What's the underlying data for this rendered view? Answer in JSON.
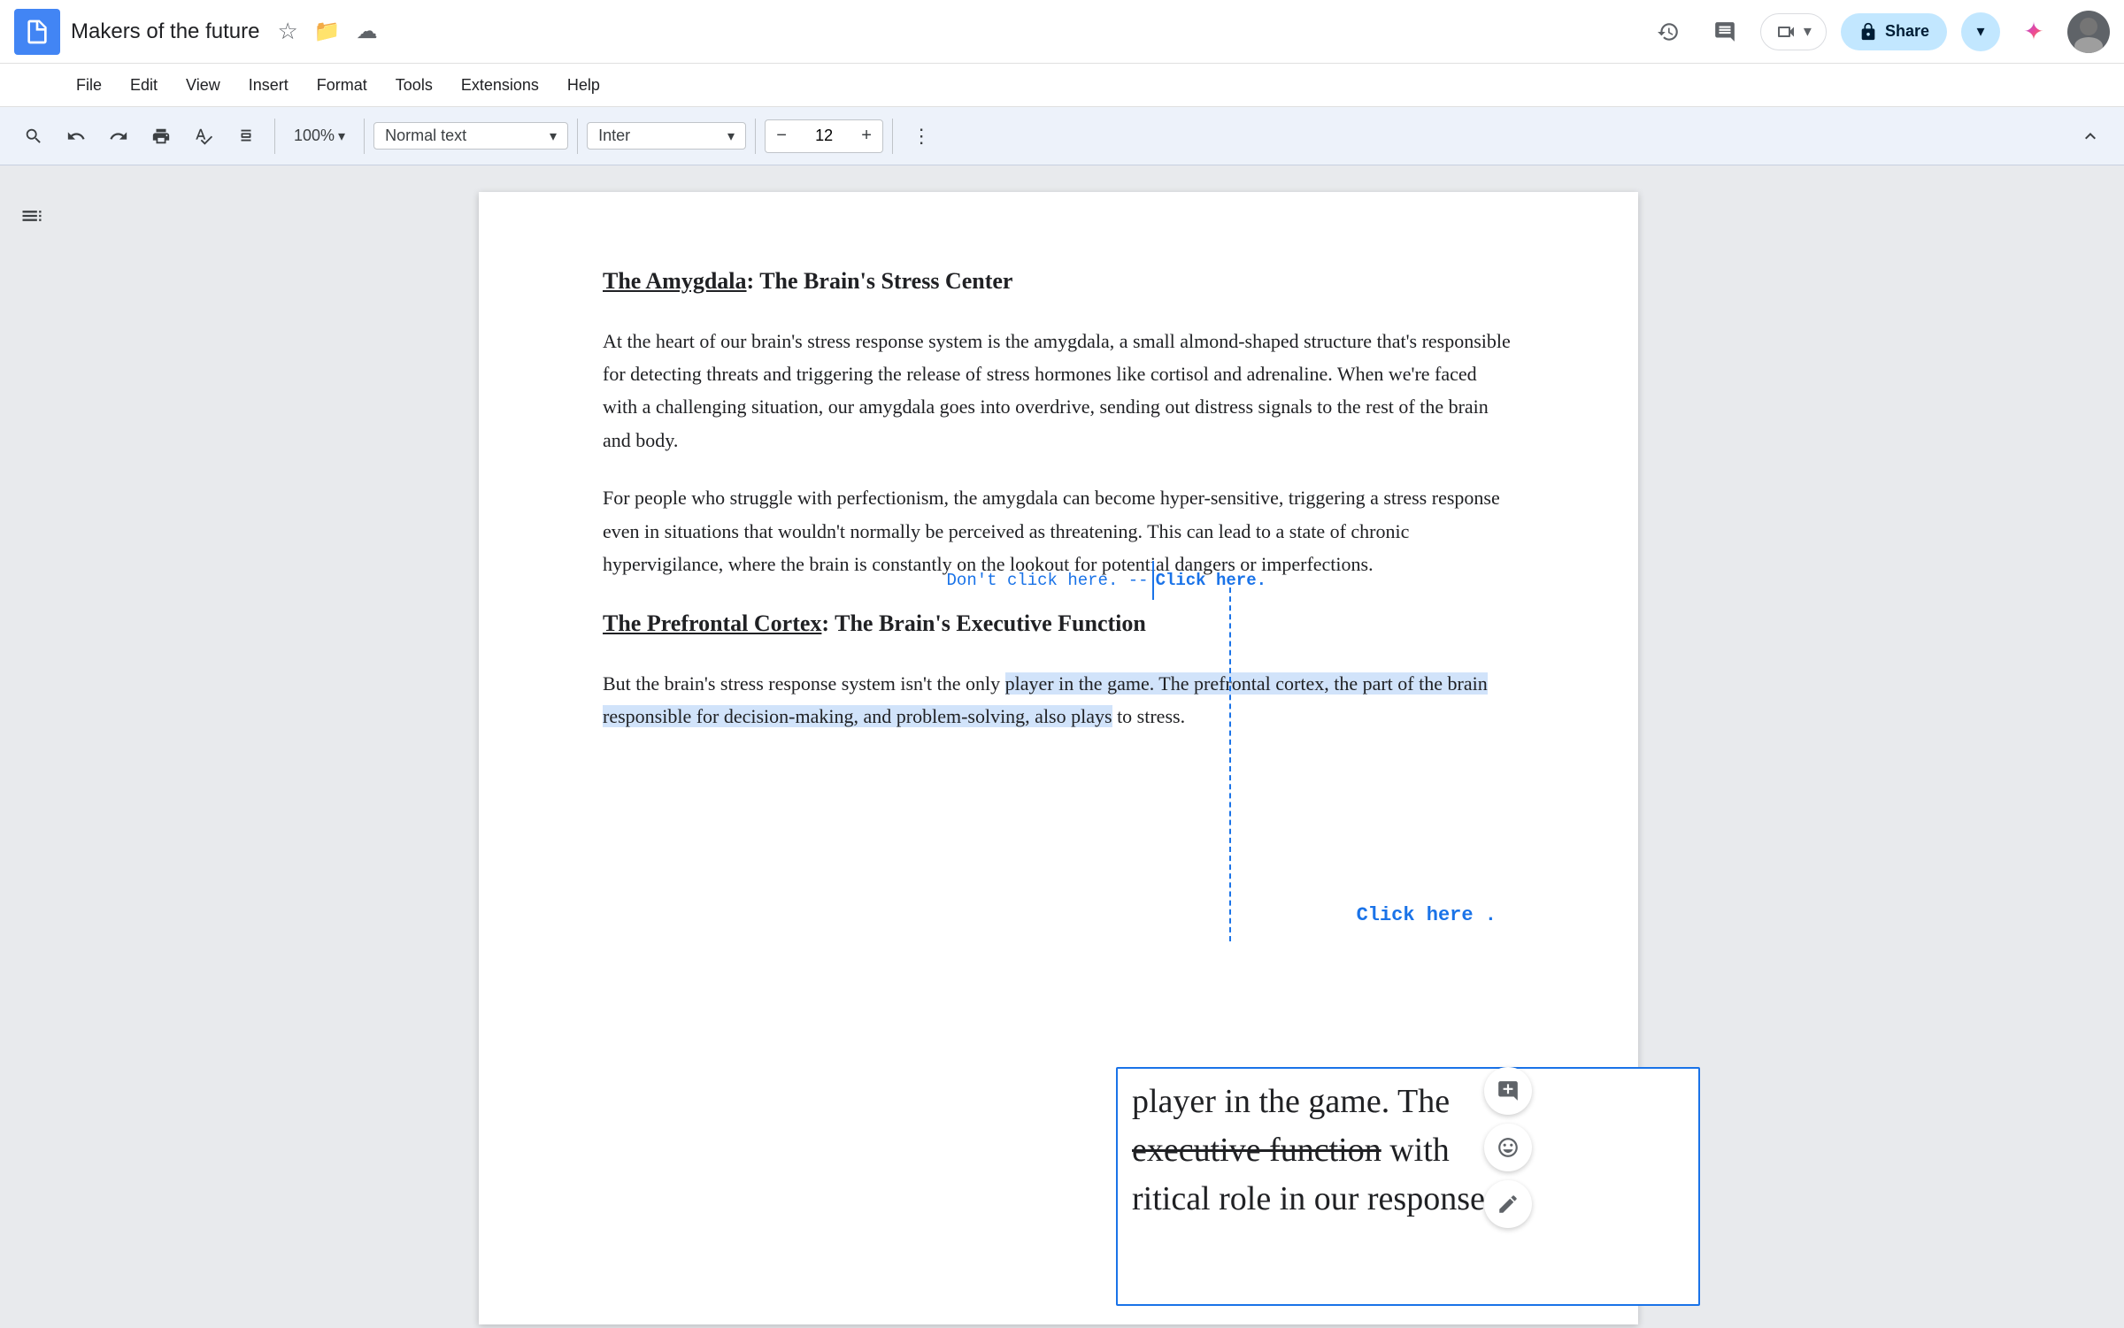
{
  "app": {
    "icon_color": "#4285f4",
    "title": "Makers of the future",
    "actions": {
      "star": "★",
      "save": "⬆",
      "cloud": "☁"
    }
  },
  "toolbar_right": {
    "history_icon": "🕐",
    "comment_icon": "💬",
    "meet_label": "Meet",
    "share_label": "Share",
    "share_icon": "🔒"
  },
  "menu": {
    "items": [
      "File",
      "Edit",
      "View",
      "Insert",
      "Format",
      "Tools",
      "Extensions",
      "Help"
    ]
  },
  "formatting_toolbar": {
    "zoom": "100%",
    "style": "Normal text",
    "font": "Inter",
    "font_size": "12",
    "more_options": "⋮"
  },
  "document": {
    "heading1": "The Amygdala: The Brain's Stress Center",
    "heading1_underline": "The Amygdala",
    "heading1_rest": ": The Brain's Stress Center",
    "para1": "At the heart of our brain's stress response system is the amygdala, a small almond-shaped structure that's responsible for detecting threats and triggering the release of stress hormones like cortisol and adrenaline. When we're faced with a challenging situation, our amygdala goes into overdrive, sending out distress signals to the rest of the brain and body.",
    "para2": "For people who struggle with perfectionism, the amygdala can become hyper-sensitive, triggering a stress response even in situations that wouldn't normally be perceived as threatening. This can lead to a state of chronic hypervigilance, where the brain is constantly on the lookout for potential dangers or imperfections.",
    "heading2": "The Prefrontal Cortex: The Brain's Executive Function",
    "heading2_underline": "The Prefrontal Cortex",
    "heading2_rest": ": The Brain's Executive Function",
    "para3_start": "But the brain's stress response system isn't the only player in the game. The prefrontal cortex, the part of the brain responsible for decision-making, and problem-solving, also plays",
    "para3_end": "to stress.",
    "selection_text_line1": "player in the game. The",
    "selection_text_line2": "executive function",
    "selection_text_line3": "with",
    "selection_text_line4": "ritical role in our response"
  },
  "comment_overlay": {
    "dont_click": "Don't click here. --",
    "click_here_inline": "Click here.",
    "click_here_bottom": "Click here ."
  },
  "action_buttons": {
    "add_comment": "+💬",
    "emoji": "😊",
    "suggest": "📝"
  }
}
